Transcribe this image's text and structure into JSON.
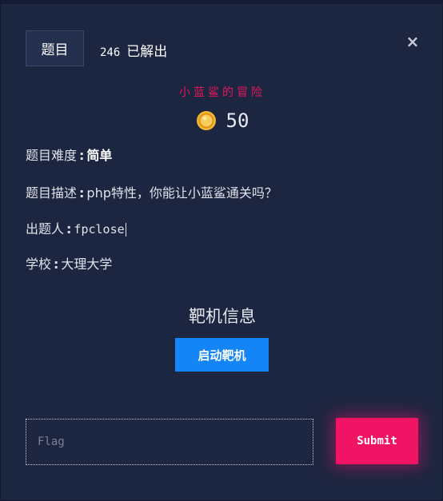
{
  "modal": {
    "tab_label": "题目",
    "solve_count": "246",
    "solve_text": "已解出",
    "close_icon": "×"
  },
  "challenge": {
    "title": "小蓝鲨的冒险",
    "points": "50",
    "coin_icon": "coin-icon",
    "difficulty_label": "题目难度",
    "difficulty_value": "简单",
    "description_label": "题目描述",
    "description_value": "php特性，你能让小蓝鲨通关吗？",
    "author_label": "出题人",
    "author_value": "fpclose",
    "school_label": "学校",
    "school_value": "大理大学"
  },
  "target": {
    "section_title": "靶机信息",
    "start_button": "启动靶机"
  },
  "flag_form": {
    "placeholder": "Flag",
    "value": "",
    "submit_label": "Submit"
  },
  "colors": {
    "background": "#1d2641",
    "title_accent": "#e8165c",
    "start_button": "#1385f7",
    "submit_button": "#f11464",
    "coin": "#f5b731"
  }
}
